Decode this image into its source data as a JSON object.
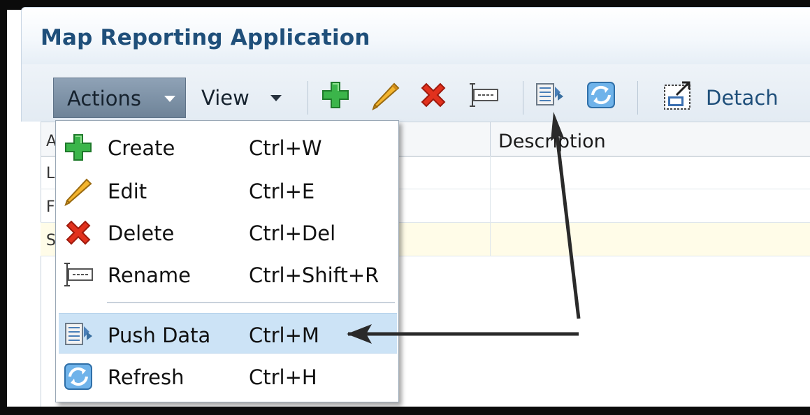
{
  "app": {
    "title": "Map Reporting Application"
  },
  "toolbar": {
    "menus": [
      {
        "label": "Actions",
        "active": true
      },
      {
        "label": "View",
        "active": false
      }
    ],
    "buttons": [
      {
        "icon": "plus-icon",
        "color": "#3bb54a"
      },
      {
        "icon": "pencil-icon",
        "color": "#e8a317"
      },
      {
        "icon": "delete-x-icon",
        "color": "#e2311d"
      },
      {
        "icon": "rename-icon",
        "color": "#6b6b6b"
      },
      {
        "icon": "push-data-icon",
        "color": "#4a7fb8"
      },
      {
        "icon": "refresh-icon",
        "color": "#3d8fd6"
      }
    ],
    "detach_label": "Detach"
  },
  "table": {
    "columns": [
      "A",
      "Description"
    ],
    "rows": [
      {
        "name_fragment": "L"
      },
      {
        "name_fragment": "F"
      },
      {
        "name_fragment": "S",
        "selected": true
      }
    ]
  },
  "actions_menu": {
    "items": [
      {
        "label": "Create",
        "shortcut": "Ctrl+W",
        "icon": "plus-icon"
      },
      {
        "label": "Edit",
        "shortcut": "Ctrl+E",
        "icon": "pencil-icon"
      },
      {
        "label": "Delete",
        "shortcut": "Ctrl+Del",
        "icon": "delete-x-icon"
      },
      {
        "label": "Rename",
        "shortcut": "Ctrl+Shift+R",
        "icon": "rename-icon"
      },
      {
        "label": "Push Data",
        "shortcut": "Ctrl+M",
        "icon": "push-data-icon",
        "highlighted": true
      },
      {
        "label": "Refresh",
        "shortcut": "Ctrl+H",
        "icon": "refresh-icon"
      }
    ]
  },
  "colors": {
    "title": "#1f4f7a",
    "menu_active": "#7d90a4",
    "highlight": "#cce3f6",
    "annotation_arrow": "#2a2a2a"
  }
}
